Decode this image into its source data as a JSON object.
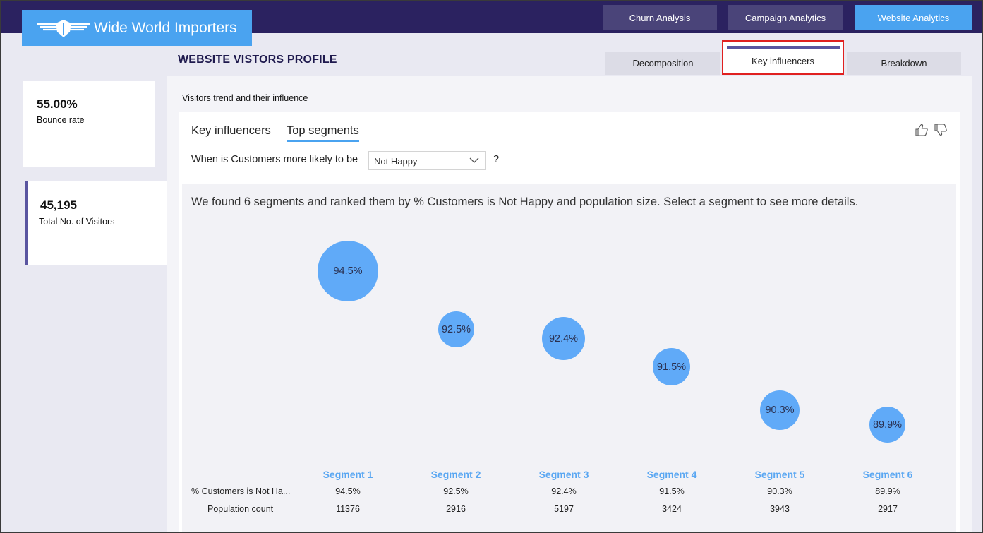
{
  "app": {
    "logo_text": "Wide World Importers"
  },
  "nav": {
    "churn": "Churn Analysis",
    "campaign": "Campaign Analytics",
    "website": "Website Analytics"
  },
  "page": {
    "title": "WEBSITE VISTORS PROFILE"
  },
  "subtabs": {
    "decomposition": "Decomposition",
    "key_influencers": "Key influencers",
    "breakdown": "Breakdown",
    "active": "Key influencers"
  },
  "kpis": {
    "bounce": {
      "value": "55.00%",
      "label": "Bounce rate"
    },
    "visitors": {
      "value": "45,195",
      "label": "Total No. of Visitors"
    }
  },
  "section": {
    "title": "Visitors trend and their influence"
  },
  "widget": {
    "tab_key": "Key influencers",
    "tab_top": "Top segments",
    "question_prefix": "When is Customers more likely to be",
    "dropdown_value": "Not Happy",
    "question_suffix": "?",
    "summary": "We found 6 segments and ranked them by % Customers is Not Happy and population size. Select a segment to see more details."
  },
  "table": {
    "row_pct_label": "% Customers is Not Ha...",
    "row_pop_label": "Population count"
  },
  "segments": [
    {
      "name": "Segment 1",
      "bubble": "94.5%",
      "pct": "94.5%",
      "population": "11376"
    },
    {
      "name": "Segment 2",
      "bubble": "92.5%",
      "pct": "92.5%",
      "population": "2916"
    },
    {
      "name": "Segment 3",
      "bubble": "92.4%",
      "pct": "92.4%",
      "population": "5197"
    },
    {
      "name": "Segment 4",
      "bubble": "91.5%",
      "pct": "91.5%",
      "population": "3424"
    },
    {
      "name": "Segment 5",
      "bubble": "90.3%",
      "pct": "90.3%",
      "population": "3943"
    },
    {
      "name": "Segment 6",
      "bubble": "89.9%",
      "pct": "89.9%",
      "population": "2917"
    }
  ],
  "colors": {
    "topbar": "#2b2260",
    "accent": "#4aa3f0",
    "bubble": "#60aaf8",
    "nav_inactive": "#4a4479",
    "active_tab_outline": "#e02020"
  }
}
